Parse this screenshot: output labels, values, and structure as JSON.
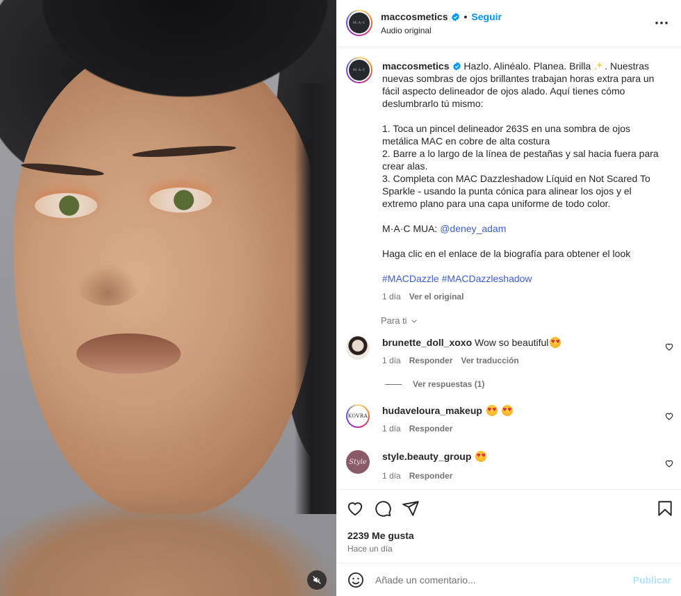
{
  "header": {
    "username": "maccosmetics",
    "dot": "•",
    "follow_label": "Seguir",
    "subtitle": "Audio original",
    "avatar_text": "M·A·C"
  },
  "caption": {
    "username": "maccosmetics",
    "intro": "Hazlo. Alinéalo. Planea. Brilla",
    "intro_rest": ". Nuestras nuevas sombras de ojos brillantes trabajan horas extra para un fácil aspecto delineador de ojos alado. Aquí tienes cómo deslumbrarlo tú mismo:",
    "step1": "1. Toca un pincel delineador 263S en una sombra de ojos metálica MAC en cobre de alta costura",
    "step2": "2. Barre a lo largo de la línea de pestañas y sal hacia fuera para crear alas.",
    "step3": "3. Completa con MAC Dazzleshadow Líquid en Not Scared To Sparkle - usando la punta cónica para alinear los ojos y el extremo plano para una capa uniforme de todo color.",
    "mua_label": "M·A·C MUA: ",
    "mua_handle": "@deney_adam",
    "cta": "Haga clic en el enlace de la biografía para obtener el look",
    "hashtag1": "#MACDazzle",
    "hashtag2": "#MACDazzleshadow",
    "time": "1 día",
    "see_original": "Ver el original"
  },
  "filter": {
    "label": "Para ti"
  },
  "comments": [
    {
      "username": "brunette_doll_xoxo",
      "text": "Wow so beautiful",
      "time": "1 día",
      "reply": "Responder",
      "translate": "Ver traducción"
    },
    {
      "username": "hudaveloura_makeup",
      "text": "",
      "time": "1 día",
      "reply": "Responder",
      "avatar_text": "KOVRA"
    },
    {
      "username": "style.beauty_group",
      "text": "",
      "time": "1 día",
      "reply": "Responder",
      "avatar_text": "Style"
    }
  ],
  "replies_label": "Ver respuestas (1)",
  "stats": {
    "likes": "2239 Me gusta",
    "time": "Hace un día"
  },
  "composer": {
    "placeholder": "Añade un comentario...",
    "publish": "Publicar"
  }
}
